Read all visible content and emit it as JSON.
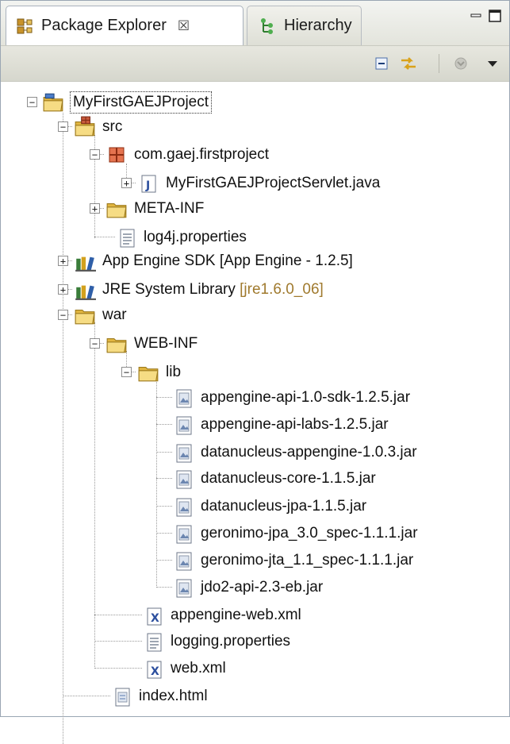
{
  "tabs": {
    "active_label": "Package Explorer",
    "active_close": "☒",
    "inactive_label": "Hierarchy"
  },
  "icons": {
    "package_explorer": "package-explorer-icon",
    "hierarchy": "hierarchy-icon",
    "minimize": "minimize-icon",
    "maximize": "maximize-icon",
    "collapse_all": "collapse-all-icon",
    "link_with_editor": "link-with-editor-icon",
    "filters": "filters-icon",
    "view_menu": "view-menu-icon"
  },
  "colors": {
    "selection_outline": "#333333",
    "library_decoration": "#a07a2e",
    "folder": "#e8c45a",
    "package": "#c0392b"
  },
  "tree": {
    "project": "MyFirstGAEJProject",
    "src": "src",
    "package": "com.gaej.firstproject",
    "servlet": "MyFirstGAEJProjectServlet.java",
    "meta_inf": "META-INF",
    "log4j": "log4j.properties",
    "appengine_sdk": "App Engine SDK [App Engine - 1.2.5]",
    "jre_name": "JRE System Library ",
    "jre_version": "[jre1.6.0_06]",
    "war": "war",
    "web_inf": "WEB-INF",
    "lib": "lib",
    "jars": [
      "appengine-api-1.0-sdk-1.2.5.jar",
      "appengine-api-labs-1.2.5.jar",
      "datanucleus-appengine-1.0.3.jar",
      "datanucleus-core-1.1.5.jar",
      "datanucleus-jpa-1.1.5.jar",
      "geronimo-jpa_3.0_spec-1.1.1.jar",
      "geronimo-jta_1.1_spec-1.1.1.jar",
      "jdo2-api-2.3-eb.jar"
    ],
    "appengine_web_xml": "appengine-web.xml",
    "logging_properties": "logging.properties",
    "web_xml": "web.xml",
    "index_html": "index.html"
  }
}
